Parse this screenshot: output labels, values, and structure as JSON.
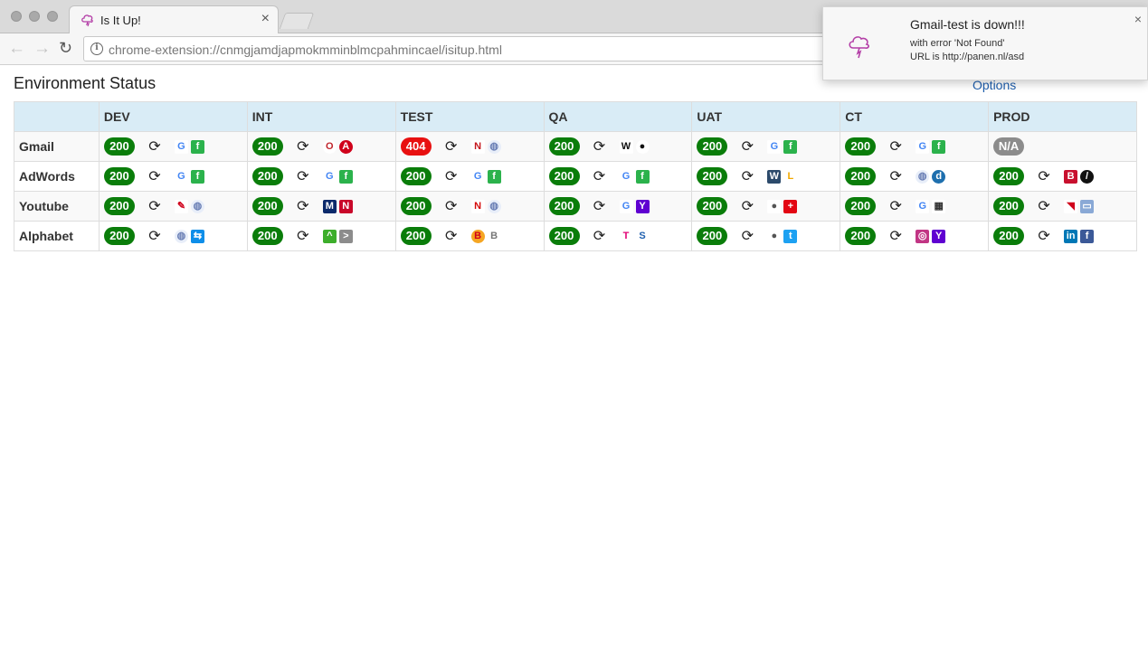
{
  "window": {
    "tab_title": "Is It Up!",
    "tab_close": "×",
    "url": "chrome-extension://cnmgjamdjapmokmminblmcpahmincael/isitup.html",
    "back": "←",
    "forward": "→",
    "reload": "↻",
    "info": "i"
  },
  "page": {
    "title": "Environment Status",
    "options_link": "Options"
  },
  "table": {
    "header_blank": "",
    "columns": [
      "DEV",
      "INT",
      "TEST",
      "QA",
      "UAT",
      "CT",
      "PROD"
    ],
    "refresh_glyph": "⟳",
    "rows": [
      {
        "name": "Gmail",
        "cells": [
          {
            "status": "200",
            "kind": "ok",
            "icons": [
              "google-icon",
              "feedly-icon"
            ]
          },
          {
            "status": "200",
            "kind": "ok",
            "icons": [
              "opera-icon",
              "abp-icon"
            ]
          },
          {
            "status": "404",
            "kind": "err",
            "icons": [
              "nypost-icon",
              "globe-icon"
            ]
          },
          {
            "status": "200",
            "kind": "ok",
            "icons": [
              "wikipedia-icon",
              "github-icon"
            ]
          },
          {
            "status": "200",
            "kind": "ok",
            "icons": [
              "google-icon",
              "feedly-icon"
            ]
          },
          {
            "status": "200",
            "kind": "ok",
            "icons": [
              "google-icon",
              "feedly-icon"
            ]
          },
          {
            "status": "N/A",
            "kind": "na",
            "icons": []
          }
        ]
      },
      {
        "name": "AdWords",
        "cells": [
          {
            "status": "200",
            "kind": "ok",
            "icons": [
              "google-icon",
              "feedly-icon"
            ]
          },
          {
            "status": "200",
            "kind": "ok",
            "icons": [
              "google-icon",
              "feedly-icon"
            ]
          },
          {
            "status": "200",
            "kind": "ok",
            "icons": [
              "google-icon",
              "feedly-icon"
            ]
          },
          {
            "status": "200",
            "kind": "ok",
            "icons": [
              "google-icon",
              "feedly-icon"
            ]
          },
          {
            "status": "200",
            "kind": "ok",
            "icons": [
              "w-icon",
              "lee-icon"
            ]
          },
          {
            "status": "200",
            "kind": "ok",
            "icons": [
              "globe-icon",
              "dolphin-icon"
            ]
          },
          {
            "status": "200",
            "kind": "ok",
            "icons": [
              "budweiser-icon",
              "slash-icon"
            ]
          }
        ]
      },
      {
        "name": "Youtube",
        "cells": [
          {
            "status": "200",
            "kind": "ok",
            "icons": [
              "pen-icon",
              "globe-icon"
            ]
          },
          {
            "status": "200",
            "kind": "ok",
            "icons": [
              "mlb-icon",
              "nba-icon"
            ]
          },
          {
            "status": "200",
            "kind": "ok",
            "icons": [
              "nfl-icon",
              "globe-icon"
            ]
          },
          {
            "status": "200",
            "kind": "ok",
            "icons": [
              "google-icon",
              "yahoo-icon"
            ]
          },
          {
            "status": "200",
            "kind": "ok",
            "icons": [
              "apple-icon",
              "swiss-icon"
            ]
          },
          {
            "status": "200",
            "kind": "ok",
            "icons": [
              "google-icon",
              "qr-icon"
            ]
          },
          {
            "status": "200",
            "kind": "ok",
            "icons": [
              "flag-icon",
              "image-icon"
            ]
          }
        ]
      },
      {
        "name": "Alphabet",
        "cells": [
          {
            "status": "200",
            "kind": "ok",
            "icons": [
              "globe-icon",
              "teamviewer-icon"
            ]
          },
          {
            "status": "200",
            "kind": "ok",
            "icons": [
              "android-icon",
              "next-icon"
            ]
          },
          {
            "status": "200",
            "kind": "ok",
            "icons": [
              "burgerking-icon",
              "buick-icon"
            ]
          },
          {
            "status": "200",
            "kind": "ok",
            "icons": [
              "tmobile-icon",
              "s-icon"
            ]
          },
          {
            "status": "200",
            "kind": "ok",
            "icons": [
              "apple-icon",
              "twitter-icon"
            ]
          },
          {
            "status": "200",
            "kind": "ok",
            "icons": [
              "instagram-icon",
              "yahoo-icon"
            ]
          },
          {
            "status": "200",
            "kind": "ok",
            "icons": [
              "linkedin-icon",
              "facebook-icon"
            ]
          }
        ]
      }
    ]
  },
  "notification": {
    "title": "Gmail-test is down!!!",
    "line1": "with error 'Not Found'",
    "line2": "URL is http://panen.nl/asd",
    "close": "×",
    "icon": "cloud-lightning-icon"
  },
  "colors": {
    "ok": "#0a7d0a",
    "error": "#e81010",
    "na": "#8c8c8c",
    "header_bg": "#d9ecf6",
    "link": "#1f5fae"
  },
  "icon_styles": {
    "google-icon": {
      "g": "G",
      "bg": "#ffffff",
      "fg": "#4285f4"
    },
    "feedly-icon": {
      "g": "f",
      "bg": "#2bb24c",
      "fg": "#ffffff"
    },
    "opera-icon": {
      "g": "O",
      "bg": "#ffffff",
      "fg": "#c0262d",
      "round": true
    },
    "abp-icon": {
      "g": "A",
      "bg": "#d0021b",
      "fg": "#ffffff",
      "round": true
    },
    "nypost-icon": {
      "g": "N",
      "bg": "#ffffff",
      "fg": "#c4161c"
    },
    "globe-icon": {
      "g": "◍",
      "bg": "#e8eef9",
      "fg": "#6a7fb5",
      "round": true
    },
    "wikipedia-icon": {
      "g": "W",
      "bg": "#ffffff",
      "fg": "#111111"
    },
    "github-icon": {
      "g": "●",
      "bg": "#ffffff",
      "fg": "#111111",
      "round": true
    },
    "w-icon": {
      "g": "W",
      "bg": "#2c4a6b",
      "fg": "#ffffff"
    },
    "lee-icon": {
      "g": "L",
      "bg": "#ffffff",
      "fg": "#f2a900"
    },
    "dolphin-icon": {
      "g": "d",
      "bg": "#1e6fae",
      "fg": "#ffffff",
      "round": true
    },
    "budweiser-icon": {
      "g": "B",
      "bg": "#c8102e",
      "fg": "#ffffff"
    },
    "slash-icon": {
      "g": "/",
      "bg": "#111111",
      "fg": "#ffffff",
      "round": true
    },
    "pen-icon": {
      "g": "✎",
      "bg": "#ffffff",
      "fg": "#d0021b"
    },
    "mlb-icon": {
      "g": "M",
      "bg": "#0b2a6b",
      "fg": "#ffffff"
    },
    "nba-icon": {
      "g": "N",
      "bg": "#c9082a",
      "fg": "#ffffff"
    },
    "nfl-icon": {
      "g": "N",
      "bg": "#ffffff",
      "fg": "#d50a0a"
    },
    "yahoo-icon": {
      "g": "Y",
      "bg": "#5f01d1",
      "fg": "#ffffff"
    },
    "apple-icon": {
      "g": "●",
      "bg": "#ffffff",
      "fg": "#555555"
    },
    "swiss-icon": {
      "g": "+",
      "bg": "#e30613",
      "fg": "#ffffff"
    },
    "qr-icon": {
      "g": "▦",
      "bg": "#ffffff",
      "fg": "#333333"
    },
    "flag-icon": {
      "g": "◥",
      "bg": "#ffffff",
      "fg": "#d0021b"
    },
    "image-icon": {
      "g": "▭",
      "bg": "#8aa9d6",
      "fg": "#ffffff"
    },
    "teamviewer-icon": {
      "g": "⇆",
      "bg": "#0e8ee9",
      "fg": "#ffffff"
    },
    "android-icon": {
      "g": "^",
      "bg": "#3dae2b",
      "fg": "#ffffff"
    },
    "next-icon": {
      "g": ">",
      "bg": "#8c8c8c",
      "fg": "#ffffff"
    },
    "burgerking-icon": {
      "g": "B",
      "bg": "#f5a623",
      "fg": "#d0021b",
      "round": true
    },
    "buick-icon": {
      "g": "B",
      "bg": "#ffffff",
      "fg": "#777777",
      "round": true
    },
    "tmobile-icon": {
      "g": "T",
      "bg": "#ffffff",
      "fg": "#e20074"
    },
    "s-icon": {
      "g": "S",
      "bg": "#ffffff",
      "fg": "#1f5fae"
    },
    "twitter-icon": {
      "g": "t",
      "bg": "#1da1f2",
      "fg": "#ffffff"
    },
    "instagram-icon": {
      "g": "◎",
      "bg": "#c13584",
      "fg": "#ffffff"
    },
    "linkedin-icon": {
      "g": "in",
      "bg": "#0077b5",
      "fg": "#ffffff"
    },
    "facebook-icon": {
      "g": "f",
      "bg": "#3b5998",
      "fg": "#ffffff"
    }
  }
}
